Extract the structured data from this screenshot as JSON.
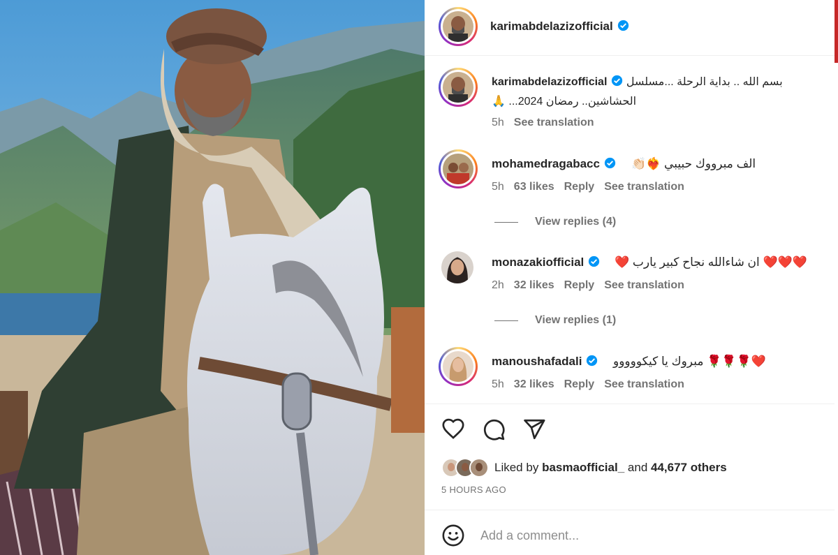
{
  "post": {
    "author": "karimabdelazizofficial",
    "caption_prefix": "بسم الله .. بداية الرحلة ...مسلسل",
    "caption_line2": "الحشاشين.. رمضان 2024... 🙏",
    "caption_age": "5h",
    "see_translation": "See translation"
  },
  "comments": [
    {
      "user": "mohamedragabacc",
      "text": "الف مبرووك حبيبي ❤️‍🔥👏🏻",
      "age": "5h",
      "likes": "63 likes",
      "reply": "Reply",
      "see_translation": "See translation",
      "view_replies": "View replies (4)"
    },
    {
      "user": "monazakiofficial",
      "text": "❤️❤️❤️ ان شاءالله نجاح كبير يارب ❤️",
      "age": "2h",
      "likes": "32 likes",
      "reply": "Reply",
      "see_translation": "See translation",
      "view_replies": "View replies (1)"
    },
    {
      "user": "manoushafadali",
      "text": "❤️🌹🌹🌹 مبروك يا كيكووووو",
      "age": "5h",
      "likes": "32 likes",
      "reply": "Reply",
      "see_translation": "See translation"
    }
  ],
  "likes_summary": {
    "prefix": "Liked by",
    "user": "basmaofficial_",
    "conjunction": "and",
    "others": "44,677 others"
  },
  "posted_ago": "5 HOURS AGO",
  "add_comment_placeholder": "Add a comment...",
  "icons": {
    "like": "heart-icon",
    "comment": "comment-bubble-icon",
    "share": "paper-plane-icon",
    "emoji": "emoji-smile-icon",
    "verified": "verified-badge-icon"
  },
  "colors": {
    "verified": "#0095f6",
    "text_primary": "#262626",
    "text_secondary": "#737373",
    "heart_red": "#e0245e"
  }
}
